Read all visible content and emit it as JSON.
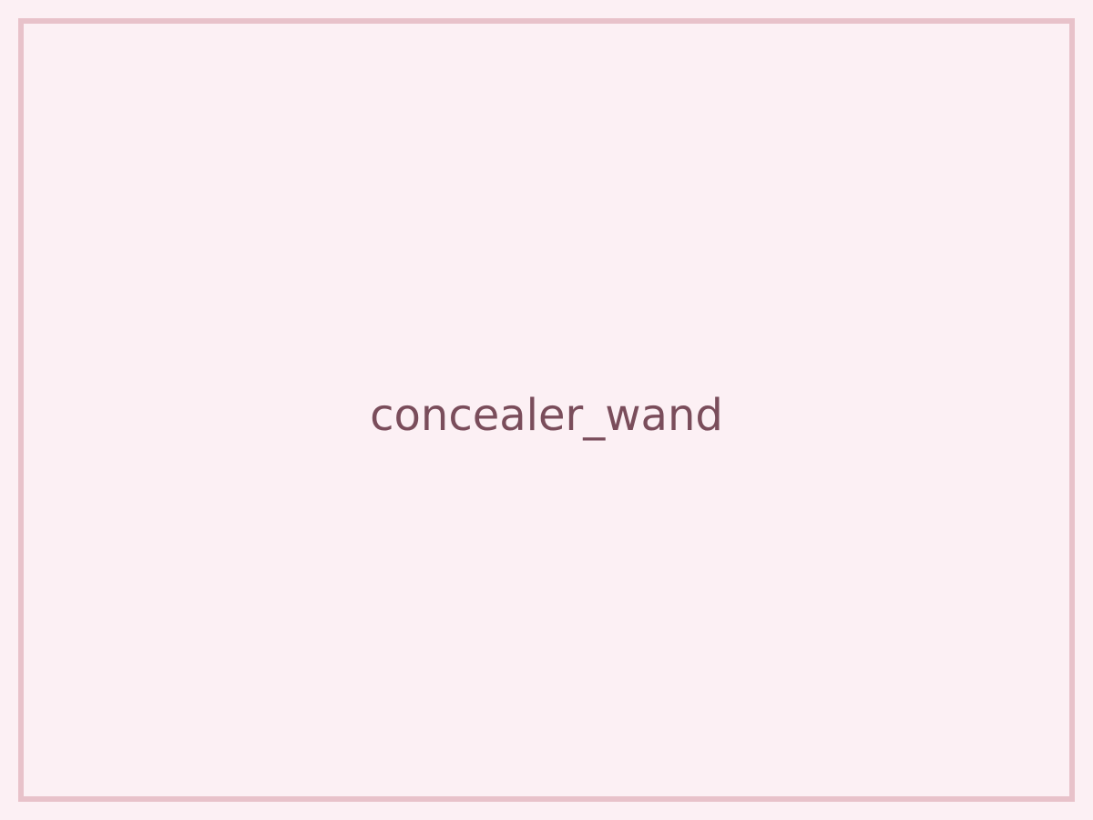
{
  "placeholder": {
    "label": "concealer_wand"
  },
  "colors": {
    "background": "#fcf0f4",
    "border": "#e8c2ca",
    "text": "#7a4d5b"
  }
}
